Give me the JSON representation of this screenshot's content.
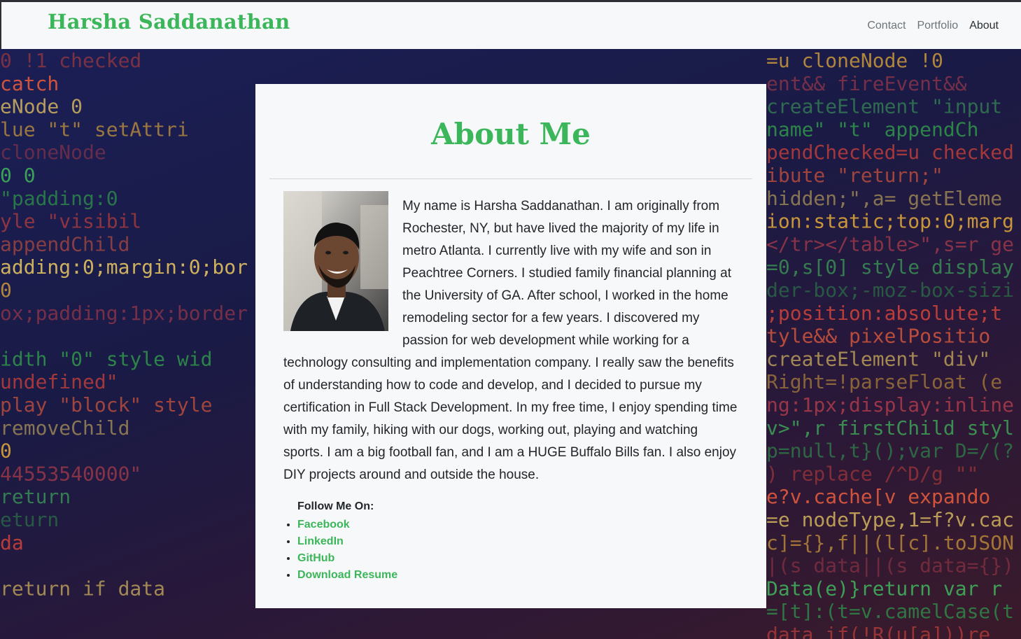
{
  "navbar": {
    "brand": "Harsha Saddanathan",
    "links": [
      {
        "label": "Contact"
      },
      {
        "label": "Portfolio"
      },
      {
        "label": "About"
      }
    ]
  },
  "about": {
    "title": "About Me",
    "bio": "My name is Harsha Saddanathan. I am originally from Rochester, NY, but have lived the majority of my life in metro Atlanta. I currently live with my wife and son in Peachtree Corners. I studied family financial planning at the University of GA. After school, I worked in the home remodeling sector for a few years. I discovered my passion for web development while working for a technology consulting and implementation company. I really saw the benefits of understanding how to code and develop, and I decided to pursue my certification in Full Stack Development. In my free time, I enjoy spending time with my family, hiking with our dogs, working out, playing and watching sports. I am a big football fan, and I am a HUGE Buffalo Bills fan. I also enjoy DIY projects around and outside the house.",
    "follow_title": "Follow Me On:",
    "social_links": [
      {
        "label": "Facebook"
      },
      {
        "label": "LinkedIn"
      },
      {
        "label": "GitHub"
      },
      {
        "label": "Download Resume"
      }
    ]
  },
  "background": {
    "code_lines_left": [
      "0          !1   checked",
      "catch",
      "eNode  0",
      "lue   \"t\"   setAttri",
      "            cloneNode",
      "    0          0",
      "       \"padding:0",
      "yle       \"visibil",
      "     appendChild",
      "adding:0;margin:0;bor",
      "                0",
      "ox;padding:1px;border",
      "",
      "idth \"0\"   style wid",
      "undefined\"",
      "play \"block\"   style",
      "   removeChild",
      "                    0",
      "44553540000\"",
      "              return",
      "eturn",
      "                      da",
      "",
      " return if        data"
    ],
    "code_lines_right": [
      "=u cloneNode !0",
      "ent&& fireEvent&&",
      " createElement \"input",
      "name\" \"t\"  appendCh",
      "pendChecked=u checked",
      "ibute  \"return;\"",
      "hidden;\",a= getEleme",
      "ion:static;top:0;marg",
      "</tr></table>\",s=r ge",
      "=0,s[0] style display",
      "der-box;-moz-box-sizi",
      ";position:absolute;t",
      "tyle&&  pixelPositio",
      "createElement \"div\"",
      "Right=!parseFloat  (e",
      "ng:1px;display:inline",
      "v>\",r firstChild styl",
      "p=null,t}();var D=/(?",
      ") replace /^D/g \"\"",
      "e?v.cache[v expando",
      "=e nodeType,1=f?v.cac",
      "c]={},f||(l[c].toJSON",
      "|(s data||(s data={})",
      "Data(e)}return var r",
      "=[t]:(t=v.camelCase(t",
      " data if(!R(u[a]))re"
    ]
  }
}
